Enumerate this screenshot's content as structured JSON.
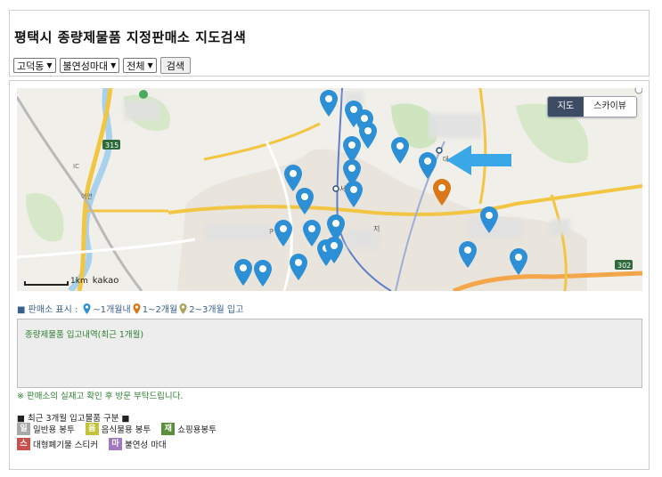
{
  "header": {
    "title": "평택시 종량제물품 지정판매소 지도검색"
  },
  "filters": {
    "district": "고덕동",
    "product": "불연성마대",
    "period": "전체",
    "search_label": "검색"
  },
  "map": {
    "type_toggle": {
      "map_label": "지도",
      "skyview_label": "스카이뷰"
    },
    "scale_label": "1km",
    "provider": "kakao",
    "road_numbers": [
      "315",
      "302"
    ],
    "place_labels": [
      "IC",
      "어연",
      "서",
      "지",
      "P",
      "대"
    ],
    "markers_recent_1m": 22,
    "markers_1_2m": 1
  },
  "legend": {
    "prefix": "■ 판매소 표시 :",
    "within_1m": "~1개월내",
    "range_1_2m": "1~2개월",
    "range_2_3m": "2~3개월 입고"
  },
  "stock_box": {
    "title": "종량제물품 입고내역(최근 1개월)"
  },
  "notice": "※ 판매소의 실재고 확인 후 방문 부탁드립니다.",
  "categories": {
    "heading": "■ 최근 3개월 입고물품 구분 ■",
    "items": [
      {
        "badge": "일",
        "label": "일반용 봉투",
        "color": "#a8a8a8"
      },
      {
        "badge": "음",
        "label": "음식물용 봉투",
        "color": "#c4c23a"
      },
      {
        "badge": "재",
        "label": "쇼핑용봉투",
        "color": "#5b8f3c"
      },
      {
        "badge": "스",
        "label": "대형폐기물 스티커",
        "color": "#c9504c"
      },
      {
        "badge": "마",
        "label": "불연성 마대",
        "color": "#a377c2"
      }
    ]
  },
  "colors": {
    "pin_recent": "#2d8fd5",
    "pin_1_2m": "#d9771a",
    "pin_2_3m": "#a9a35c",
    "arrow": "#3aa7e8"
  }
}
